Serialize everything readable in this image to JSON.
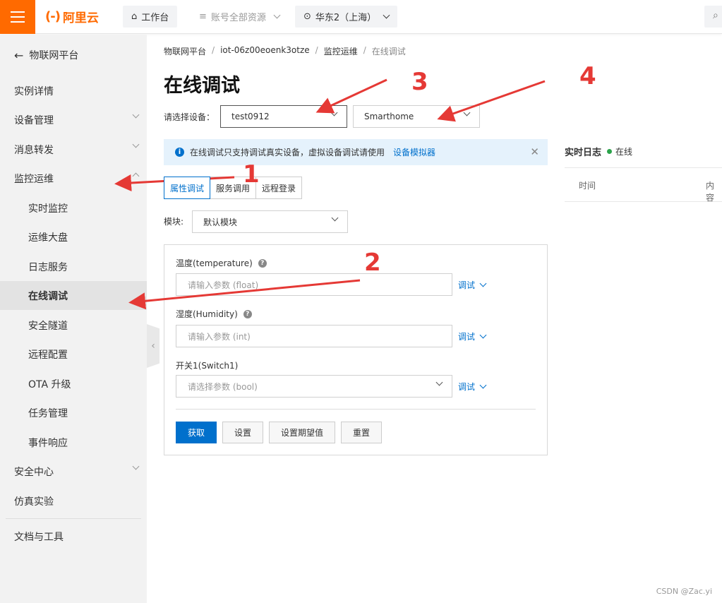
{
  "topbar": {
    "logo_text": "阿里云",
    "workbench": "工作台",
    "resources": "账号全部资源",
    "region": "华东2（上海）"
  },
  "sidebar": {
    "back_label": "物联网平台",
    "items": [
      {
        "label": "实例详情"
      },
      {
        "label": "设备管理"
      },
      {
        "label": "消息转发"
      },
      {
        "label": "监控运维"
      },
      {
        "label": "实时监控"
      },
      {
        "label": "运维大盘"
      },
      {
        "label": "日志服务"
      },
      {
        "label": "在线调试"
      },
      {
        "label": "安全隧道"
      },
      {
        "label": "远程配置"
      },
      {
        "label": "OTA 升级"
      },
      {
        "label": "任务管理"
      },
      {
        "label": "事件响应"
      },
      {
        "label": "安全中心"
      },
      {
        "label": "仿真实验"
      },
      {
        "label": "文档与工具"
      }
    ]
  },
  "breadcrumb": [
    "物联网平台",
    "iot-06z00eoenk3otze",
    "监控运维",
    "在线调试"
  ],
  "page_title": "在线调试",
  "device_label": "请选择设备：",
  "device_value": "test0912",
  "product_value": "Smarthome",
  "notice": {
    "text": "在线调试只支持调试真实设备，虚拟设备调试请使用",
    "link": "设备模拟器",
    "close": "✕"
  },
  "tabs": [
    "属性调试",
    "服务调用",
    "远程登录"
  ],
  "module_label": "模块:",
  "module_value": "默认模块",
  "fields": [
    {
      "label": "温度(temperature)",
      "placeholder": "请输入参数 (float)",
      "action": "调试"
    },
    {
      "label": "湿度(Humidity)",
      "placeholder": "请输入参数 (int)",
      "action": "调试"
    },
    {
      "label": "开关1(Switch1)",
      "placeholder": "请选择参数 (bool)",
      "action": "调试"
    }
  ],
  "buttons": {
    "get": "获取",
    "set": "设置",
    "set_expected": "设置期望值",
    "reset": "重置"
  },
  "log": {
    "title": "实时日志",
    "status": "在线",
    "col_time": "时间",
    "col_content": "内容"
  },
  "annotations": [
    "1",
    "2",
    "3",
    "4"
  ],
  "watermark": "CSDN @Zac.yi",
  "colors": {
    "brand": "#ff6a00",
    "primary": "#0070cc",
    "annotation": "#e53935",
    "online": "#2aa34a"
  }
}
